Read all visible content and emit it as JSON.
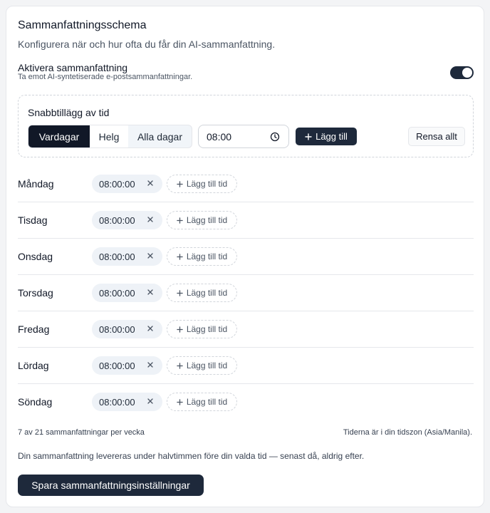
{
  "header": {
    "title": "Sammanfattningsschema",
    "subtitle": "Konfigurera när och hur ofta du får din AI-sammanfattning."
  },
  "enable": {
    "label": "Aktivera sammanfattning",
    "description": "Ta emot AI-syntetiserade e-postsammanfattningar.",
    "on": true
  },
  "quick_add": {
    "label": "Snabbtillägg av tid",
    "segments": [
      "Vardagar",
      "Helg",
      "Alla dagar"
    ],
    "selected_segment": "Vardagar",
    "time_value": "08:00",
    "add_label": "Lägg till",
    "clear_label": "Rensa allt"
  },
  "schedule": {
    "add_time_label": "Lägg till tid",
    "days": [
      {
        "name": "Måndag",
        "time": "08:00:00"
      },
      {
        "name": "Tisdag",
        "time": "08:00:00"
      },
      {
        "name": "Onsdag",
        "time": "08:00:00"
      },
      {
        "name": "Torsdag",
        "time": "08:00:00"
      },
      {
        "name": "Fredag",
        "time": "08:00:00"
      },
      {
        "name": "Lördag",
        "time": "08:00:00"
      },
      {
        "name": "Söndag",
        "time": "08:00:00"
      }
    ]
  },
  "footer": {
    "count": "7 av 21 sammanfattningar per vecka",
    "timezone": "Tiderna är i din tidszon (Asia/Manila).",
    "note": "Din sammanfattning levereras under halvtimmen före din valda tid — senast då, aldrig efter.",
    "save_label": "Spara sammanfattningsinställningar"
  },
  "colors": {
    "accent": "#1e293b",
    "chip_bg": "#eef2f7",
    "border": "#e5e7eb"
  },
  "icons": {
    "time": "clock-icon",
    "add": "plus-icon",
    "remove": "close-icon"
  }
}
